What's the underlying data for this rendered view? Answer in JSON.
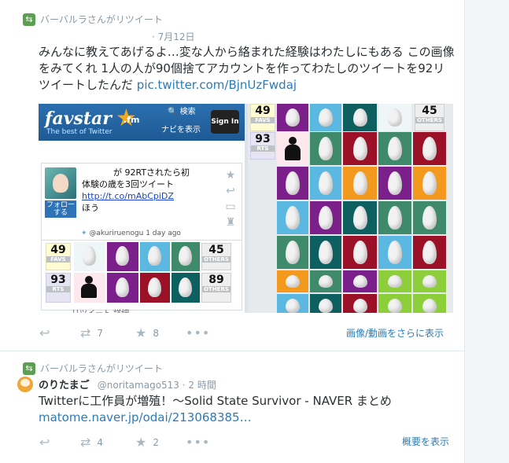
{
  "tweets": [
    {
      "retweeted_by": "バーバルラさんがリツイート",
      "date": "· 7月12日",
      "text": "みんなに教えてあげるよ…変な人から絡まれた経験はわたしにもある この画像をみてくれ 1人の人が90個捨てアカウントを作ってわたしのツイートを92リツイートしたんだ",
      "link": "pic.twitter.com/BjnUzFwdaj",
      "retweet_count": "7",
      "favorite_count": "8",
      "more_label": "画像/動画をさらに表示"
    },
    {
      "retweeted_by": "バーバルラさんがリツイート",
      "author_name": "のりたまご",
      "handle_time": "@noritamago513 · 2 時間",
      "text": "Twitterに工作員が増殖！〜Solid State Survivor - NAVER まとめ",
      "link": "matome.naver.jp/odai/213068385…",
      "retweet_count": "4",
      "favorite_count": "2",
      "more_label": "概要を表示"
    }
  ],
  "favstar": {
    "logo": "favstar",
    "logo_suffix": ".fm",
    "tagline": "The best of Twitter",
    "search": "🔍 検索",
    "nav": "ナビを表示",
    "signin": "Sign In",
    "card_line1": "が 92RTされたら初",
    "card_line2": "体験の歳を3回ツイート",
    "card_link": "http://t.co/mAbCpiDZ",
    "card_line4": "ほう",
    "follow": "フォロー する",
    "card_meta": "@akuriruenogu 1 day ago",
    "card_more": "リツイート 詳細",
    "stats_left": [
      {
        "num": "49",
        "label": "FAVS"
      },
      {
        "num": "93",
        "label": "RTS"
      }
    ],
    "stats_right": [
      {
        "num": "45",
        "label": "OTHERS"
      },
      {
        "num": "89",
        "label": "OTHERS"
      }
    ],
    "big_stats_left": [
      {
        "num": "49",
        "label": "FAVS"
      },
      {
        "num": "93",
        "label": "RTS"
      }
    ],
    "big_stats_right": [
      {
        "num": "45",
        "label": "OTHERS"
      }
    ]
  },
  "icons": [
    "retweet-icon",
    "reply-icon",
    "star-icon",
    "more-icon",
    "search-icon"
  ],
  "colors": {
    "link": "#2b7bb9",
    "retweet_green": "#5c9e52",
    "favstar_blue": "#2b6fb0"
  }
}
